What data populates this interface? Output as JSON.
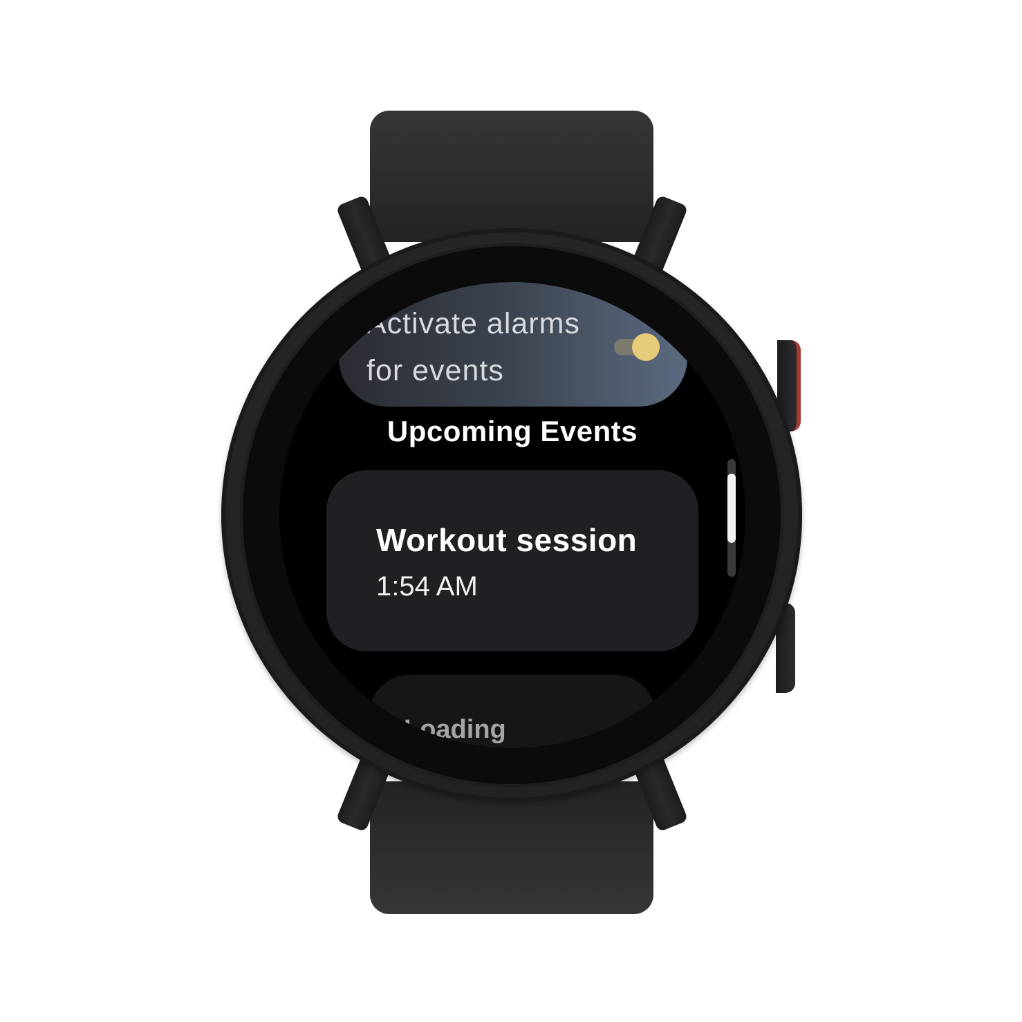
{
  "alarms_toggle": {
    "label": "Activate alarms\nfor events",
    "state": "on",
    "accent_color": "#e6cc7a"
  },
  "upcoming": {
    "section_title": "Upcoming Events",
    "events": [
      {
        "title": "Workout session",
        "time": "1:54 AM"
      }
    ],
    "loading_text": "Loading"
  },
  "scroll": {
    "position_fraction": 0.3
  }
}
